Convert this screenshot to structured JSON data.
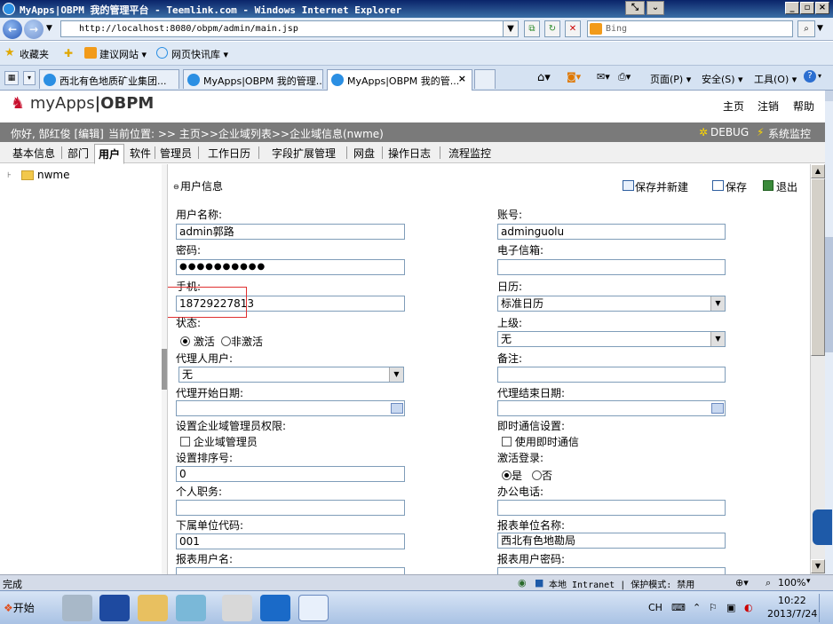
{
  "window": {
    "title": "MyApps|OBPM 我的管理平台 - Teemlink.com - Windows Internet Explorer"
  },
  "address": {
    "url": "http://localhost:8080/obpm/admin/main.jsp",
    "search_placeholder": "Bing"
  },
  "favorites": {
    "label": "收藏夹",
    "items": [
      "建议网站 ▾",
      "网页快讯库 ▾"
    ]
  },
  "browser_tabs": [
    {
      "label": "西北有色地质矿业集团..."
    },
    {
      "label": "MyApps|OBPM 我的管理..."
    },
    {
      "label": "MyApps|OBPM 我的管..."
    }
  ],
  "browser_toolbar": {
    "page": "页面(P) ▾",
    "safety": "安全(S) ▾",
    "tools": "工具(O) ▾"
  },
  "app": {
    "logo_brand": "myApps",
    "logo_suffix": "|OBPM",
    "nav": [
      "主页",
      "注销",
      "帮助"
    ],
    "greeting": "你好, 郜红俊 [编辑]",
    "location_label": "当前位置: >> 主页>>企业域列表>>企业域信息(nwme)",
    "debug": "DEBUG",
    "monitor": "系统监控"
  },
  "module_tabs": [
    "基本信息",
    "部门",
    "用户",
    "软件",
    "管理员",
    "工作日历",
    "字段扩展管理",
    "网盘",
    "操作日志",
    "流程监控"
  ],
  "tree": {
    "root": "nwme"
  },
  "form": {
    "section_title": "用户信息",
    "save_new": "保存并新建",
    "save": "保存",
    "exit": "退出",
    "fields": {
      "username_label": "用户名称:",
      "username_value": "admin郭路",
      "account_label": "账号:",
      "account_value": "adminguolu",
      "password_label": "密码:",
      "password_value": "●●●●●●●●●●",
      "email_label": "电子信箱:",
      "email_value": "",
      "mobile_label": "手机:",
      "mobile_value": "18729227813",
      "calendar_label": "日历:",
      "calendar_value": "标准日历",
      "status_label": "状态:",
      "status_active": "激活",
      "status_inactive": "非激活",
      "superior_label": "上级:",
      "superior_value": "无",
      "proxy_label": "代理人用户:",
      "proxy_value": "无",
      "remark_label": "备注:",
      "proxy_start_label": "代理开始日期:",
      "proxy_end_label": "代理结束日期:",
      "domain_admin_label": "设置企业域管理员权限:",
      "domain_admin_checkbox": "企业域管理员",
      "im_label": "即时通信设置:",
      "im_checkbox": "使用即时通信",
      "sort_label": "设置排序号:",
      "sort_value": "0",
      "activate_login_label": "激活登录:",
      "yes": "是",
      "no": "否",
      "position_label": "个人职务:",
      "office_phone_label": "办公电话:",
      "unit_code_label": "下属单位代码:",
      "unit_code_value": "001",
      "report_unit_label": "报表单位名称:",
      "report_unit_value": "西北有色地勘局",
      "report_user_label": "报表用户名:",
      "report_pwd_label": "报表用户密码:"
    }
  },
  "statusbar": {
    "left": "完成",
    "zone": "本地 Intranet | 保护模式: 禁用",
    "zoom": "100%"
  },
  "taskbar": {
    "start": "开始",
    "lang": "CH",
    "time": "10:22",
    "date": "2013/7/24"
  }
}
